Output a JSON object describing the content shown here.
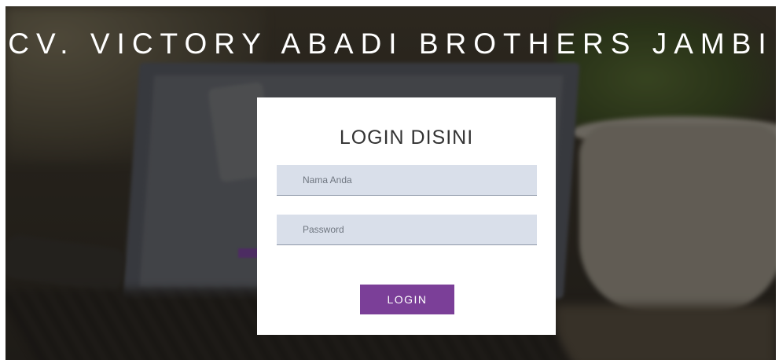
{
  "header": {
    "title": "CV. VICTORY ABADI BROTHERS JAMBI"
  },
  "login": {
    "heading": "LOGIN DISINI",
    "name_placeholder": "Nama Anda",
    "password_placeholder": "Password",
    "button_label": "LOGIN"
  },
  "colors": {
    "button": "#7b3f98",
    "input_bg": "#d9dfea",
    "card_bg": "#ffffff",
    "title_text": "#ffffff"
  }
}
